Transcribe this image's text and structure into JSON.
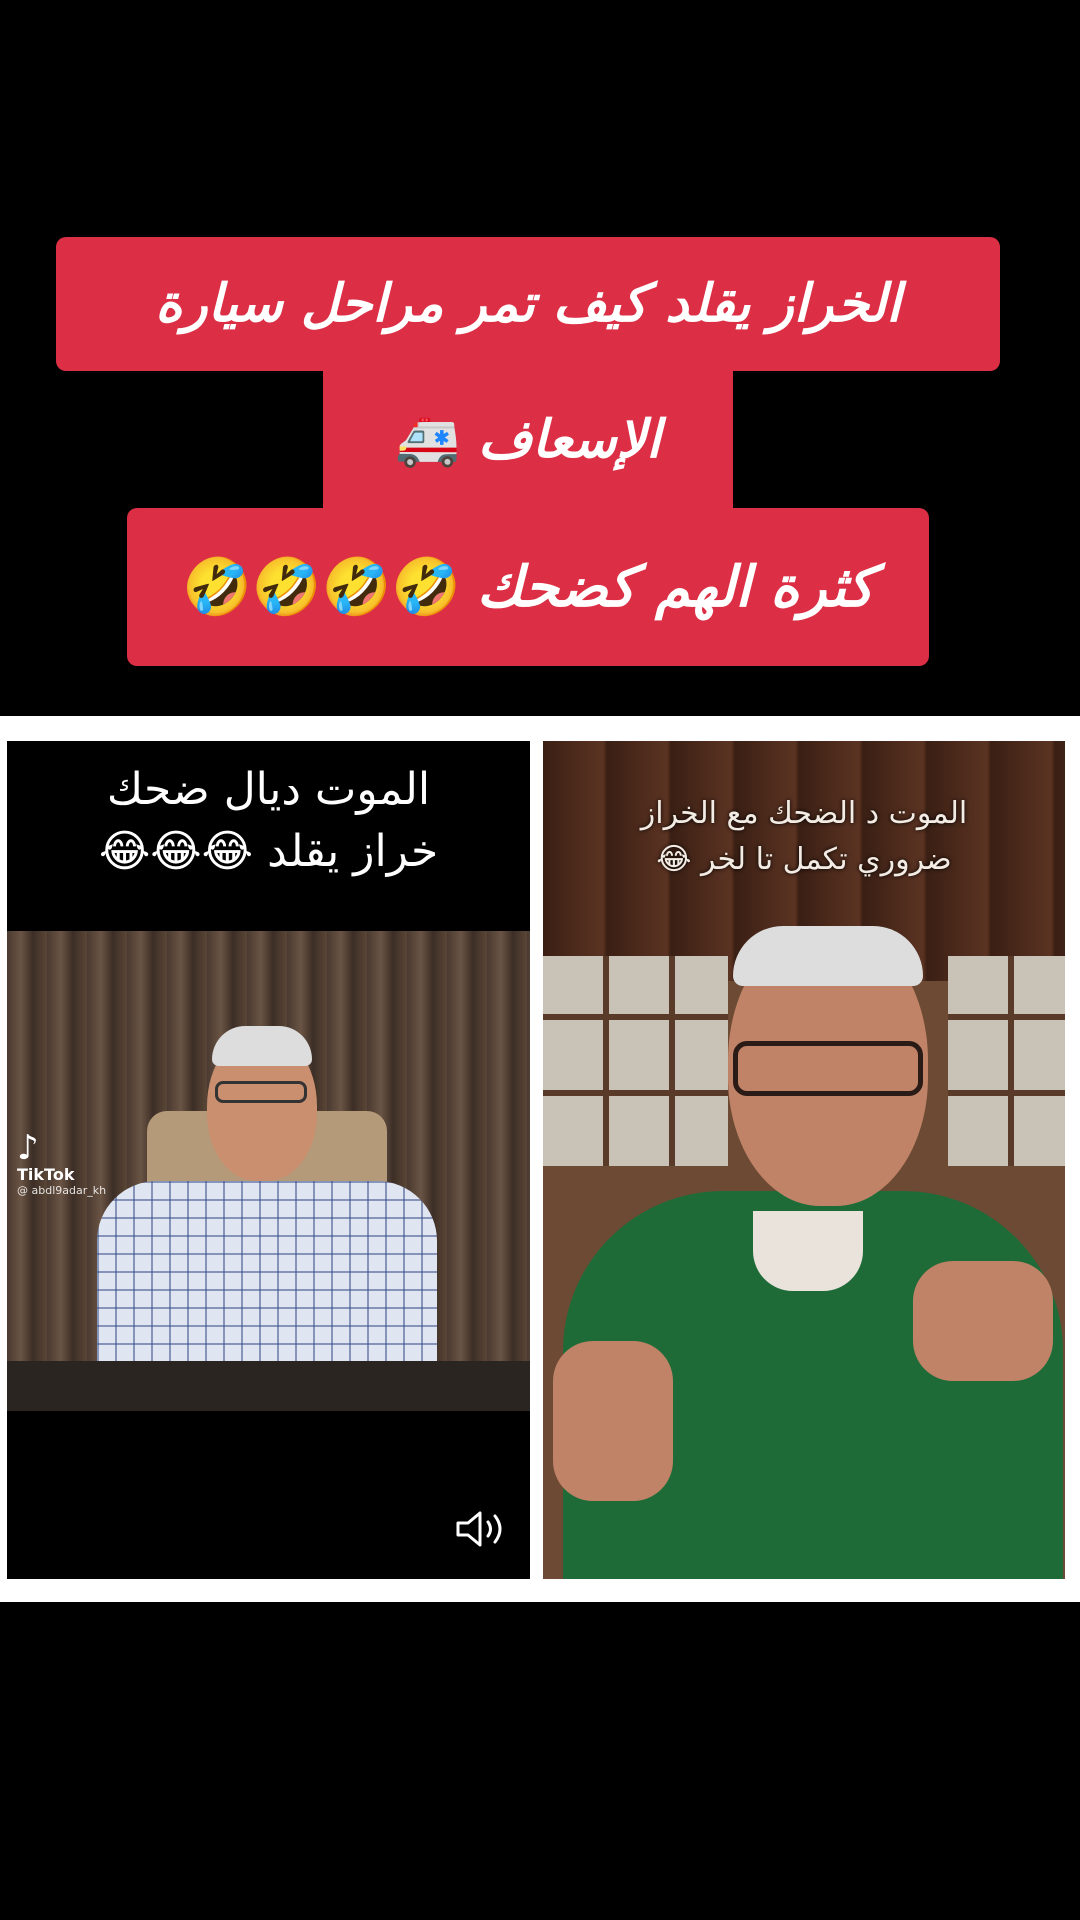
{
  "title_banner": {
    "line1": "الخراز يقلد كيف تمر مراحل سيارة",
    "line2": "الإسعاف",
    "line2_emoji": "🚑",
    "line3": "كثرة الهم كضحك",
    "line3_emojis": "🤣🤣🤣🤣",
    "color": "#dc2f45"
  },
  "left_video": {
    "caption_line1": "الموت ديال ضحك",
    "caption_line2": "خراز يقلد",
    "caption_emojis": "😂😂😂",
    "watermark_brand": "TikTok",
    "watermark_user": "@ abdl9adar_kh",
    "sound_icon": "volume-icon"
  },
  "right_video": {
    "caption_line1": "الموت د الضحك مع الخراز",
    "caption_line2": "ضروري تكمل تا لخر",
    "caption_emoji": "😂"
  }
}
